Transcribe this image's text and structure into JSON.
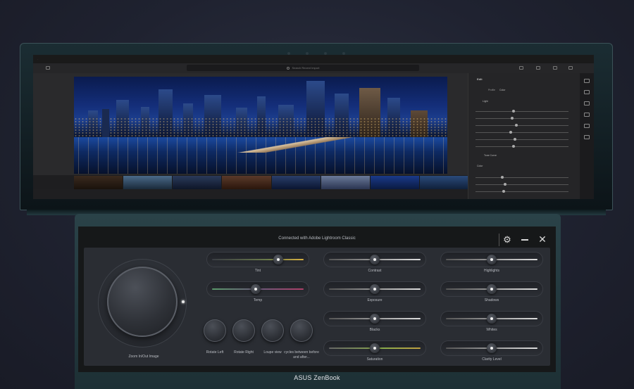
{
  "lightroom": {
    "search_placeholder": "Search Recent Import",
    "edit_title": "Edit",
    "profile_label": "Profile",
    "profile_value": "Color",
    "light_section": "Light",
    "color_section": "Color",
    "tone_curve": "Tone Curve"
  },
  "control_panel": {
    "title": "Connected with Adobe Lightroom Classic",
    "dial_label": "Zoom In/Out Image",
    "buttons": [
      {
        "label": "Rotate Left"
      },
      {
        "label": "Rotate Right"
      },
      {
        "label": "Loupe view"
      },
      {
        "label": "cycles between before and after..."
      }
    ],
    "sliders": [
      {
        "label": "Tint",
        "value": 0.72
      },
      {
        "label": "Temp",
        "value": 0.48
      },
      {
        "label": "Contrast",
        "value": 0.5
      },
      {
        "label": "Exposure",
        "value": 0.5
      },
      {
        "label": "Blacks",
        "value": 0.5
      },
      {
        "label": "Saturation",
        "value": 0.5
      },
      {
        "label": "Highlights",
        "value": 0.5
      },
      {
        "label": "Shadows",
        "value": 0.5
      },
      {
        "label": "Whites",
        "value": 0.5
      },
      {
        "label": "Clarity Level",
        "value": 0.5
      }
    ]
  },
  "brand": "ASUS ZenBook"
}
